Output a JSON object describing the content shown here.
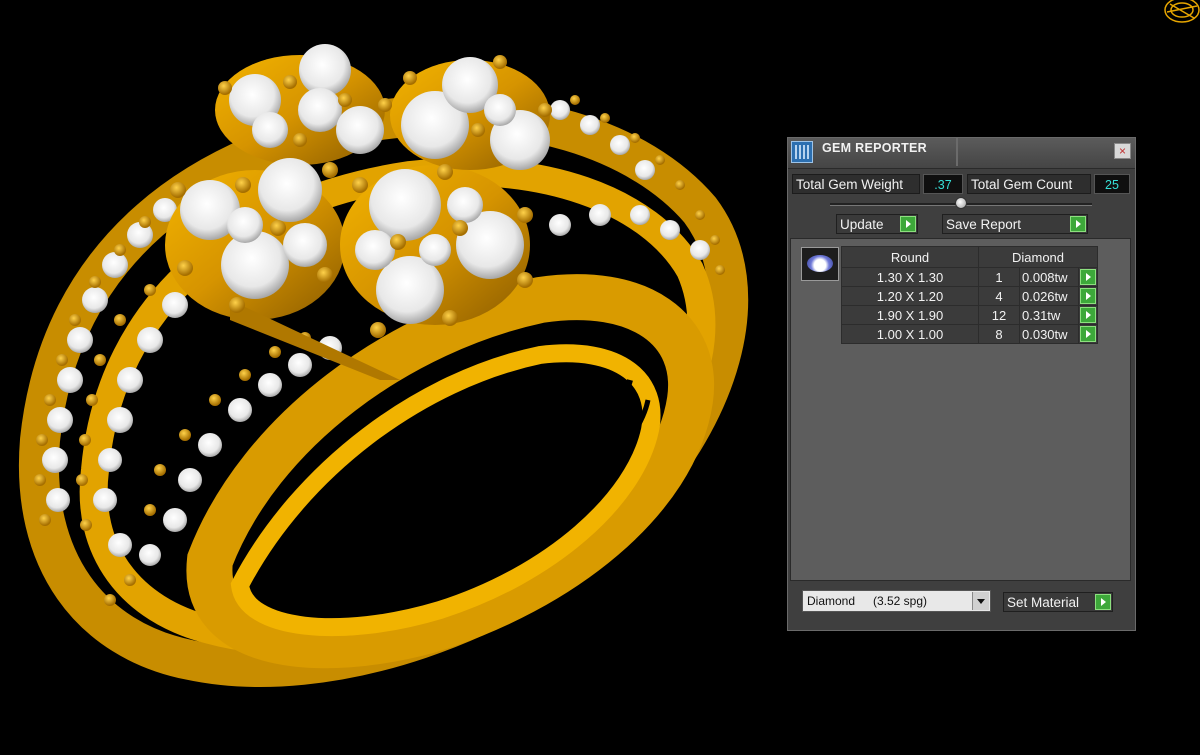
{
  "viewport": {
    "subject": "3D ring model",
    "metal_color": "#e6a500",
    "gem_color": "#f4f4f4",
    "corner_icon": "ring-wireframe-icon"
  },
  "panel": {
    "title": "GEM REPORTER",
    "close_label": "×",
    "total_weight_label": "Total Gem Weight",
    "total_weight_value": ".37",
    "total_count_label": "Total Gem Count",
    "total_count_value": "25",
    "update_label": "Update",
    "save_report_label": "Save Report",
    "table": {
      "header_shape": "Round",
      "header_material": "Diamond",
      "rows": [
        {
          "size": "1.30 X 1.30",
          "count": "1",
          "weight": "0.008tw"
        },
        {
          "size": "1.20 X 1.20",
          "count": "4",
          "weight": "0.026tw"
        },
        {
          "size": "1.90 X 1.90",
          "count": "12",
          "weight": "0.31tw"
        },
        {
          "size": "1.00 X 1.00",
          "count": "8",
          "weight": "0.030tw"
        }
      ]
    },
    "material_select": {
      "name": "Diamond",
      "spg": "(3.52 spg)"
    },
    "set_material_label": "Set Material",
    "accent_value_color": "#36e0d8",
    "go_button_color": "#3da83a"
  }
}
